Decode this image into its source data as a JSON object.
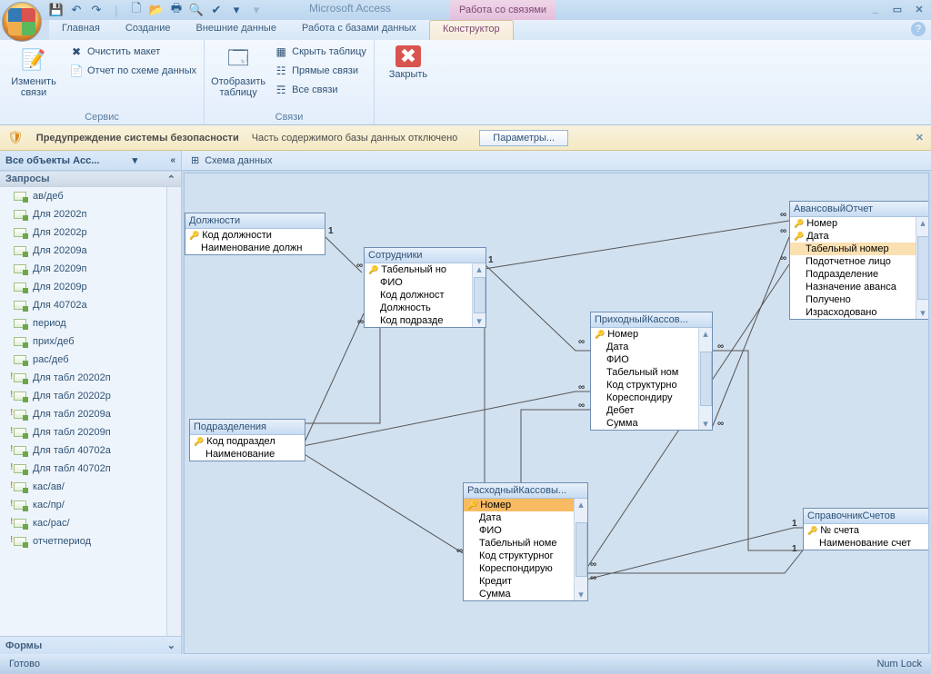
{
  "title": {
    "app": "Microsoft Access",
    "context_tab": "Работа со связями"
  },
  "tabs": [
    "Главная",
    "Создание",
    "Внешние данные",
    "Работа с базами данных",
    "Конструктор"
  ],
  "ribbon": {
    "g1": {
      "edit": "Изменить\nсвязи",
      "clear": "Очистить макет",
      "report": "Отчет по схеме данных",
      "label": "Сервис"
    },
    "g2": {
      "show_table": "Отобразить\nтаблицу",
      "hide_table": "Скрыть таблицу",
      "direct": "Прямые связи",
      "all": "Все связи",
      "label": "Связи"
    },
    "g3": {
      "close": "Закрыть"
    }
  },
  "security": {
    "title": "Предупреждение системы безопасности",
    "text": "Часть содержимого базы данных отключено",
    "btn": "Параметры..."
  },
  "nav": {
    "header": "Все объекты Acc...",
    "group_queries": "Запросы",
    "items": [
      {
        "t": "ав/деб",
        "ico": "q"
      },
      {
        "t": "Для 20202п",
        "ico": "q"
      },
      {
        "t": "Для 20202р",
        "ico": "q"
      },
      {
        "t": "Для 20209а",
        "ico": "q"
      },
      {
        "t": "Для 20209п",
        "ico": "q"
      },
      {
        "t": "Для 20209р",
        "ico": "q"
      },
      {
        "t": "Для 40702а",
        "ico": "q"
      },
      {
        "t": "период",
        "ico": "q"
      },
      {
        "t": "прих/деб",
        "ico": "q"
      },
      {
        "t": "рас/деб",
        "ico": "q"
      },
      {
        "t": "Для табл 20202п",
        "ico": "qe"
      },
      {
        "t": "Для табл 20202р",
        "ico": "qe"
      },
      {
        "t": "Для табл 20209а",
        "ico": "qe"
      },
      {
        "t": "Для табл 20209п",
        "ico": "qe"
      },
      {
        "t": "Для табл 40702а",
        "ico": "qe"
      },
      {
        "t": "Для табл 40702п",
        "ico": "qe"
      },
      {
        "t": "кас/ав/",
        "ico": "qe"
      },
      {
        "t": "кас/пр/",
        "ico": "qe"
      },
      {
        "t": "кас/рас/",
        "ico": "qe"
      },
      {
        "t": "отчетпериод",
        "ico": "qe"
      }
    ],
    "footer": "Формы"
  },
  "doc_tab": "Схема данных",
  "tables": {
    "dol": {
      "title": "Должности",
      "fields": [
        {
          "n": "Код должности",
          "k": true
        },
        {
          "n": "Наименование должн",
          "k": false
        }
      ]
    },
    "sotr": {
      "title": "Сотрудники",
      "fields": [
        {
          "n": "Табельный но",
          "k": true
        },
        {
          "n": "ФИО",
          "k": false
        },
        {
          "n": "Код должност",
          "k": false
        },
        {
          "n": "Должность",
          "k": false
        },
        {
          "n": "Код подразде",
          "k": false
        }
      ]
    },
    "podr": {
      "title": "Подразделения",
      "fields": [
        {
          "n": "Код подраздел",
          "k": true
        },
        {
          "n": "Наименование",
          "k": false
        }
      ]
    },
    "prih": {
      "title": "ПриходныйКассов...",
      "fields": [
        {
          "n": "Номер",
          "k": true
        },
        {
          "n": "Дата",
          "k": false
        },
        {
          "n": "ФИО",
          "k": false
        },
        {
          "n": "Табельный ном",
          "k": false
        },
        {
          "n": "Код структурно",
          "k": false
        },
        {
          "n": "Кореспондиру",
          "k": false
        },
        {
          "n": "Дебет",
          "k": false
        },
        {
          "n": "Сумма",
          "k": false
        }
      ]
    },
    "rash": {
      "title": "РасходныйКассовы...",
      "fields": [
        {
          "n": "Номер",
          "k": true,
          "sel": true
        },
        {
          "n": "Дата",
          "k": false
        },
        {
          "n": "ФИО",
          "k": false
        },
        {
          "n": "Табельный номе",
          "k": false
        },
        {
          "n": "Код структурног",
          "k": false
        },
        {
          "n": "Кореспондирую",
          "k": false
        },
        {
          "n": "Кредит",
          "k": false
        },
        {
          "n": "Сумма",
          "k": false
        }
      ]
    },
    "avan": {
      "title": "АвансовыйОтчет",
      "fields": [
        {
          "n": "Номер",
          "k": true
        },
        {
          "n": "Дата",
          "k": true
        },
        {
          "n": "Табельный номер",
          "k": false,
          "hl": true
        },
        {
          "n": "Подотчетное лицо",
          "k": false
        },
        {
          "n": "Подразделение",
          "k": false
        },
        {
          "n": "Назначение аванса",
          "k": false
        },
        {
          "n": "Получено",
          "k": false
        },
        {
          "n": "Израсходовано",
          "k": false
        }
      ]
    },
    "spr": {
      "title": "СправочникСчетов",
      "fields": [
        {
          "n": "№ счета",
          "k": true
        },
        {
          "n": "Наименование счет",
          "k": false
        }
      ]
    }
  },
  "status": {
    "ready": "Готово",
    "numlock": "Num Lock"
  }
}
